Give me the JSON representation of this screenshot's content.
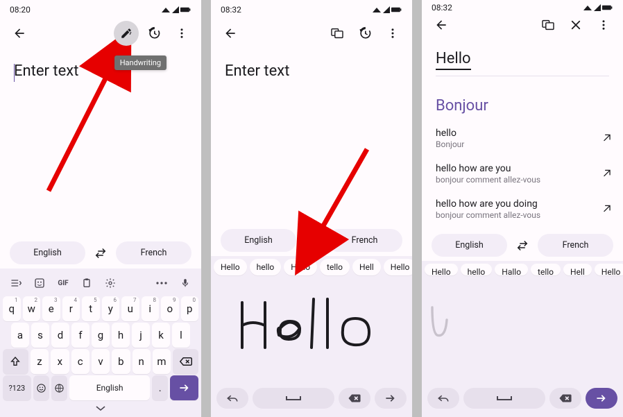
{
  "screens": {
    "s1": {
      "status_time": "08:20",
      "placeholder": "Enter text",
      "tooltip": "Handwriting",
      "lang_src": "English",
      "lang_tgt": "French",
      "keyboard": {
        "row1": [
          "q",
          "w",
          "e",
          "r",
          "t",
          "y",
          "u",
          "i",
          "o",
          "p"
        ],
        "row1_hints": [
          "1",
          "2",
          "3",
          "4",
          "5",
          "6",
          "7",
          "8",
          "9",
          "0"
        ],
        "row2": [
          "a",
          "s",
          "d",
          "f",
          "g",
          "h",
          "j",
          "k",
          "l"
        ],
        "row3": [
          "z",
          "x",
          "c",
          "v",
          "b",
          "n",
          "m"
        ],
        "sym_label": "?123",
        "space_label": "English"
      }
    },
    "s2": {
      "status_time": "08:32",
      "placeholder": "Enter text",
      "lang_src": "English",
      "lang_tgt": "French",
      "suggestions": [
        "Hello",
        "hello",
        "Hallo",
        "tello",
        "Hell",
        "Hello"
      ]
    },
    "s3": {
      "status_time": "08:32",
      "entered": "Hello",
      "translation": "Bonjour",
      "history": [
        {
          "src": "hello",
          "tgt": "Bonjour"
        },
        {
          "src": "hello how are you",
          "tgt": "bonjour comment allez-vous"
        },
        {
          "src": "hello how are you doing",
          "tgt": "bonjour comment allez-vous"
        }
      ],
      "lang_src": "English",
      "lang_tgt": "French",
      "suggestions": [
        "Hello",
        "hello",
        "Hallo",
        "tello",
        "Hell",
        "Hello"
      ]
    }
  }
}
